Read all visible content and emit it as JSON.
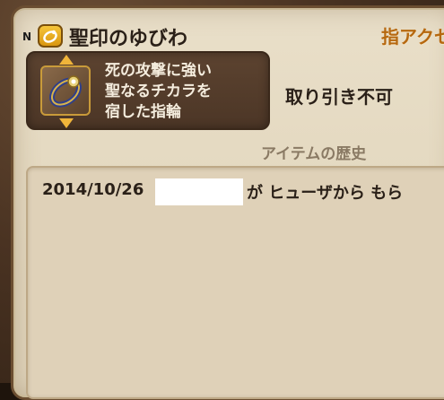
{
  "title_bar": {
    "rarity_badge": "N",
    "category_icon": "ring-category-icon",
    "item_name": "聖印のゆびわ",
    "tab_label": "指アクセ"
  },
  "description": {
    "item_icon": "ring-icon",
    "lines": [
      "死の攻撃に強い",
      "聖なるチカラを",
      "宿した指輪"
    ]
  },
  "trade_status": "取り引き不可",
  "history": {
    "header": "アイテムの歴史",
    "entries": [
      {
        "date": "2014/10/26",
        "text": "が ヒューザから もら"
      }
    ]
  },
  "colors": {
    "panel_bg": "#e5dac2",
    "desc_box_bg": "#4c3626",
    "accent_orange": "#b6680f",
    "arrow_gold": "#f0b53a"
  }
}
